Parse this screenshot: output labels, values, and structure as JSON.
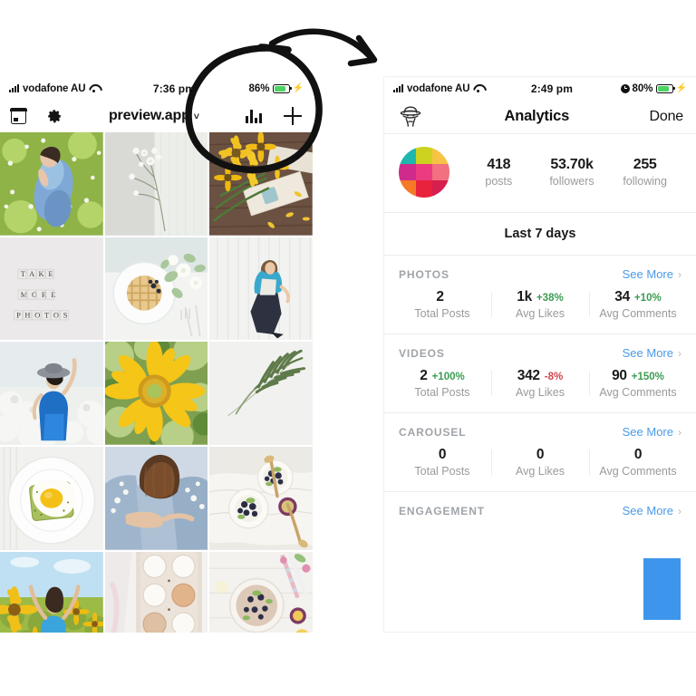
{
  "left_phone": {
    "status_bar": {
      "carrier": "vodafone AU",
      "time": "7:36 pm",
      "battery_pct": "86%",
      "signal_icon": "signal-bars-icon",
      "wifi_icon": "wifi-icon",
      "battery_icon": "battery-icon",
      "charging_icon": "lightning-bolt-icon"
    },
    "toolbar": {
      "calendar_icon": "calendar-icon",
      "settings_icon": "gear-icon",
      "title": "preview.app",
      "dropdown_icon": "chevron-down-icon",
      "analytics_icon": "bar-chart-icon",
      "add_icon": "plus-icon"
    },
    "grid": {
      "tiles": [
        {
          "name": "girl-lying-in-daisy-field",
          "alt": "Girl in denim lying on grass with daisies"
        },
        {
          "name": "white-flowers-in-vase",
          "alt": "White wildflowers against grey wall"
        },
        {
          "name": "sunflowers-on-wood",
          "alt": "Sunflower bouquet on rustic wood"
        },
        {
          "name": "take-more-photos-scrabble",
          "alt": "TAKE MORE PHOTOS scrabble tiles",
          "text_lines": [
            "T A K E",
            "M O R E",
            "P H O T O S"
          ]
        },
        {
          "name": "waffles-with-flowers",
          "alt": "Waffles on plate with white flowers"
        },
        {
          "name": "woman-blue-jacket-white-wall",
          "alt": "Woman in blue jacket by white wall"
        },
        {
          "name": "woman-hat-white-field",
          "alt": "Woman with hat in white flower field"
        },
        {
          "name": "yellow-sunflower-closeup",
          "alt": "Close up yellow sunflower"
        },
        {
          "name": "palm-leaf-minimal",
          "alt": "Single palm leaf on white"
        },
        {
          "name": "egg-avocado-toast",
          "alt": "Fried egg on avocado toast"
        },
        {
          "name": "two-women-denim-hug",
          "alt": "Two women in denim embracing"
        },
        {
          "name": "berry-bowls-flatlay",
          "alt": "Berry breakfast bowls flatlay"
        },
        {
          "name": "sunflower-field-arms-up",
          "alt": "Woman arms up in sunflower field"
        },
        {
          "name": "egg-carton-flatlay",
          "alt": "Eggs in carton flatlay"
        },
        {
          "name": "smoothie-bowl-flatlay",
          "alt": "Smoothie bowl with fruit flatlay"
        }
      ]
    }
  },
  "annotation": {
    "circle_label": "hand-drawn-circle-highlight",
    "arrow_label": "hand-drawn-arrow",
    "stroke_color": "#111111"
  },
  "right_phone": {
    "status_bar": {
      "carrier": "vodafone AU",
      "time": "2:49 pm",
      "battery_pct": "80%",
      "signal_icon": "signal-bars-icon",
      "wifi_icon": "wifi-icon",
      "alarm_icon": "alarm-clock-icon",
      "battery_icon": "battery-icon",
      "charging_icon": "lightning-bolt-icon"
    },
    "navbar": {
      "spy_icon": "spy-detective-icon",
      "title": "Analytics",
      "done_label": "Done"
    },
    "profile": {
      "avatar_icon": "instagram-grid-avatar",
      "avatar_colors": [
        "#1fb6b0",
        "#ccd21f",
        "#f6c344",
        "#cf2a8c",
        "#ec3b7f",
        "#f2707f",
        "#f47a28",
        "#e8223c",
        "#d61f4e"
      ],
      "stats": [
        {
          "value": "418",
          "label": "posts"
        },
        {
          "value": "53.70k",
          "label": "followers"
        },
        {
          "value": "255",
          "label": "following"
        }
      ]
    },
    "period_label": "Last 7 days",
    "see_more_label": "See More",
    "chevron_icon": "chevron-right-icon",
    "sections": [
      {
        "title": "PHOTOS",
        "metrics": [
          {
            "value": "2",
            "delta": "",
            "dir": "",
            "caption": "Total Posts"
          },
          {
            "value": "1k",
            "delta": "+38%",
            "dir": "up",
            "caption": "Avg Likes"
          },
          {
            "value": "34",
            "delta": "+10%",
            "dir": "up",
            "caption": "Avg Comments"
          }
        ]
      },
      {
        "title": "VIDEOS",
        "metrics": [
          {
            "value": "2",
            "delta": "+100%",
            "dir": "up",
            "caption": "Total Posts"
          },
          {
            "value": "342",
            "delta": "-8%",
            "dir": "down",
            "caption": "Avg Likes"
          },
          {
            "value": "90",
            "delta": "+150%",
            "dir": "up",
            "caption": "Avg Comments"
          }
        ]
      },
      {
        "title": "CAROUSEL",
        "metrics": [
          {
            "value": "0",
            "delta": "",
            "dir": "",
            "caption": "Total Posts"
          },
          {
            "value": "0",
            "delta": "",
            "dir": "",
            "caption": "Avg Likes"
          },
          {
            "value": "0",
            "delta": "",
            "dir": "",
            "caption": "Avg Comments"
          }
        ]
      }
    ],
    "engagement": {
      "title": "ENGAGEMENT",
      "chart": {
        "type": "bar",
        "bar_color": "#3d96ec",
        "bars": [
          {
            "x_pct": 83,
            "height_pct": 62,
            "width_pct": 12
          }
        ]
      }
    },
    "colors": {
      "accent_link": "#4a9ae8",
      "positive": "#3b9c52",
      "negative": "#d0454c",
      "bar": "#3d96ec"
    }
  }
}
